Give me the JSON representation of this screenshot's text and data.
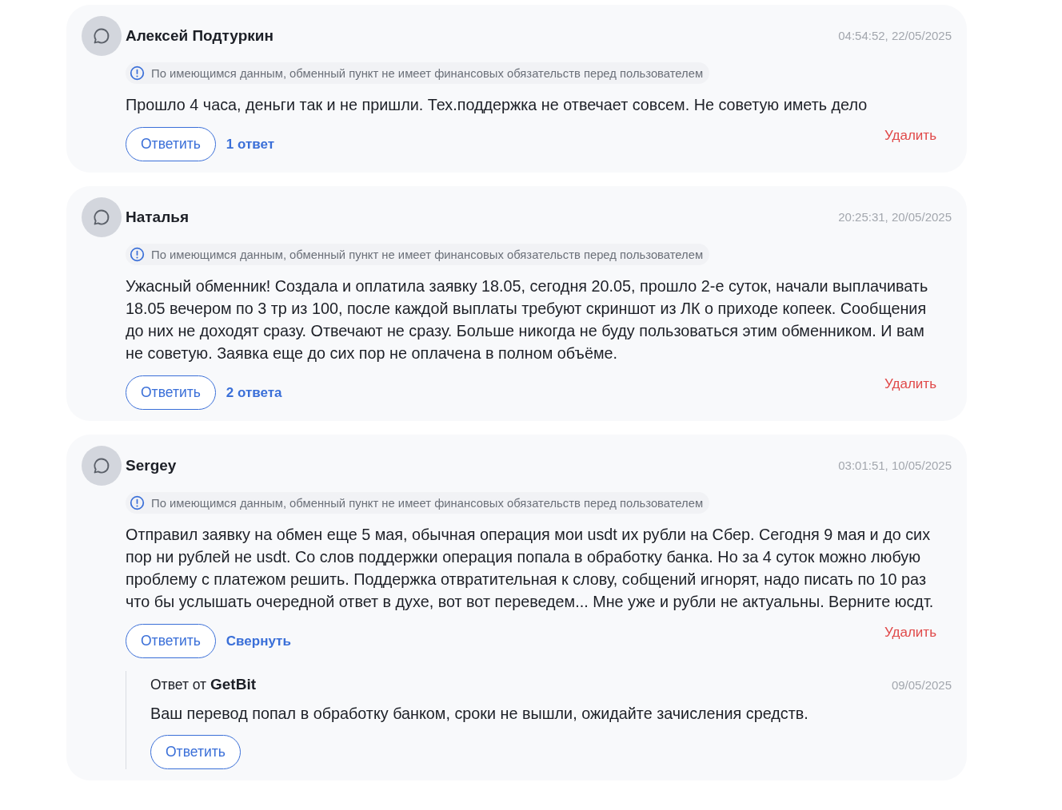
{
  "reviews": [
    {
      "author": "Алексей Подтуркин",
      "time": "04:54:52, 22/05/2025",
      "notice": "По имеющимся данным, обменный пункт не имеет финансовых обязательств перед пользователем",
      "text": "Прошло 4 часа, деньги так и не пришли. Тех.поддержка не отвечает совсем. Не советую иметь дело",
      "reply_button": "Ответить",
      "toggle": "1 ответ",
      "delete": "Удалить"
    },
    {
      "author": "Наталья",
      "time": "20:25:31, 20/05/2025",
      "notice": "По имеющимся данным, обменный пункт не имеет финансовых обязательств перед пользователем",
      "text": "Ужасный обменник! Создала и оплатила заявку 18.05, сегодня 20.05, прошло 2-е суток, начали выплачивать 18.05 вечером по 3 тр из 100, после каждой выплаты требуют скриншот из ЛК о приходе копеек. Сообщения до них не доходят сразу. Отвечают не сразу. Больше никогда не буду пользоваться этим обменником. И вам не советую. Заявка еще до сих пор не оплачена в полном объёме.",
      "reply_button": "Ответить",
      "toggle": "2 ответа",
      "delete": "Удалить"
    },
    {
      "author": "Sergey",
      "time": "03:01:51, 10/05/2025",
      "notice": "По имеющимся данным, обменный пункт не имеет финансовых обязательств перед пользователем",
      "text": "Отправил заявку на обмен еще 5 мая, обычная операция мои usdt их рубли на Сбер. Сегодня 9 мая и до сих пор ни рублей не usdt. Со слов поддержки операция попала в обработку банка. Но за 4 суток можно любую проблему с платежом решить. Поддержка отвратительная к слову, собщений игнорят, надо писать по 10 раз что бы услышать очередной ответ в духе, вот вот переведем... Мне уже и рубли не актуальны. Верните юсдт.",
      "reply_button": "Ответить",
      "toggle": "Свернуть",
      "delete": "Удалить",
      "replies": [
        {
          "from": "Ответ от **GetBit**",
          "date": "09/05/2025",
          "text": "Ваш перевод попал в обработку банком, сроки не вышли, ожидайте зачисления средств.",
          "reply_button": "Ответить"
        }
      ]
    }
  ]
}
